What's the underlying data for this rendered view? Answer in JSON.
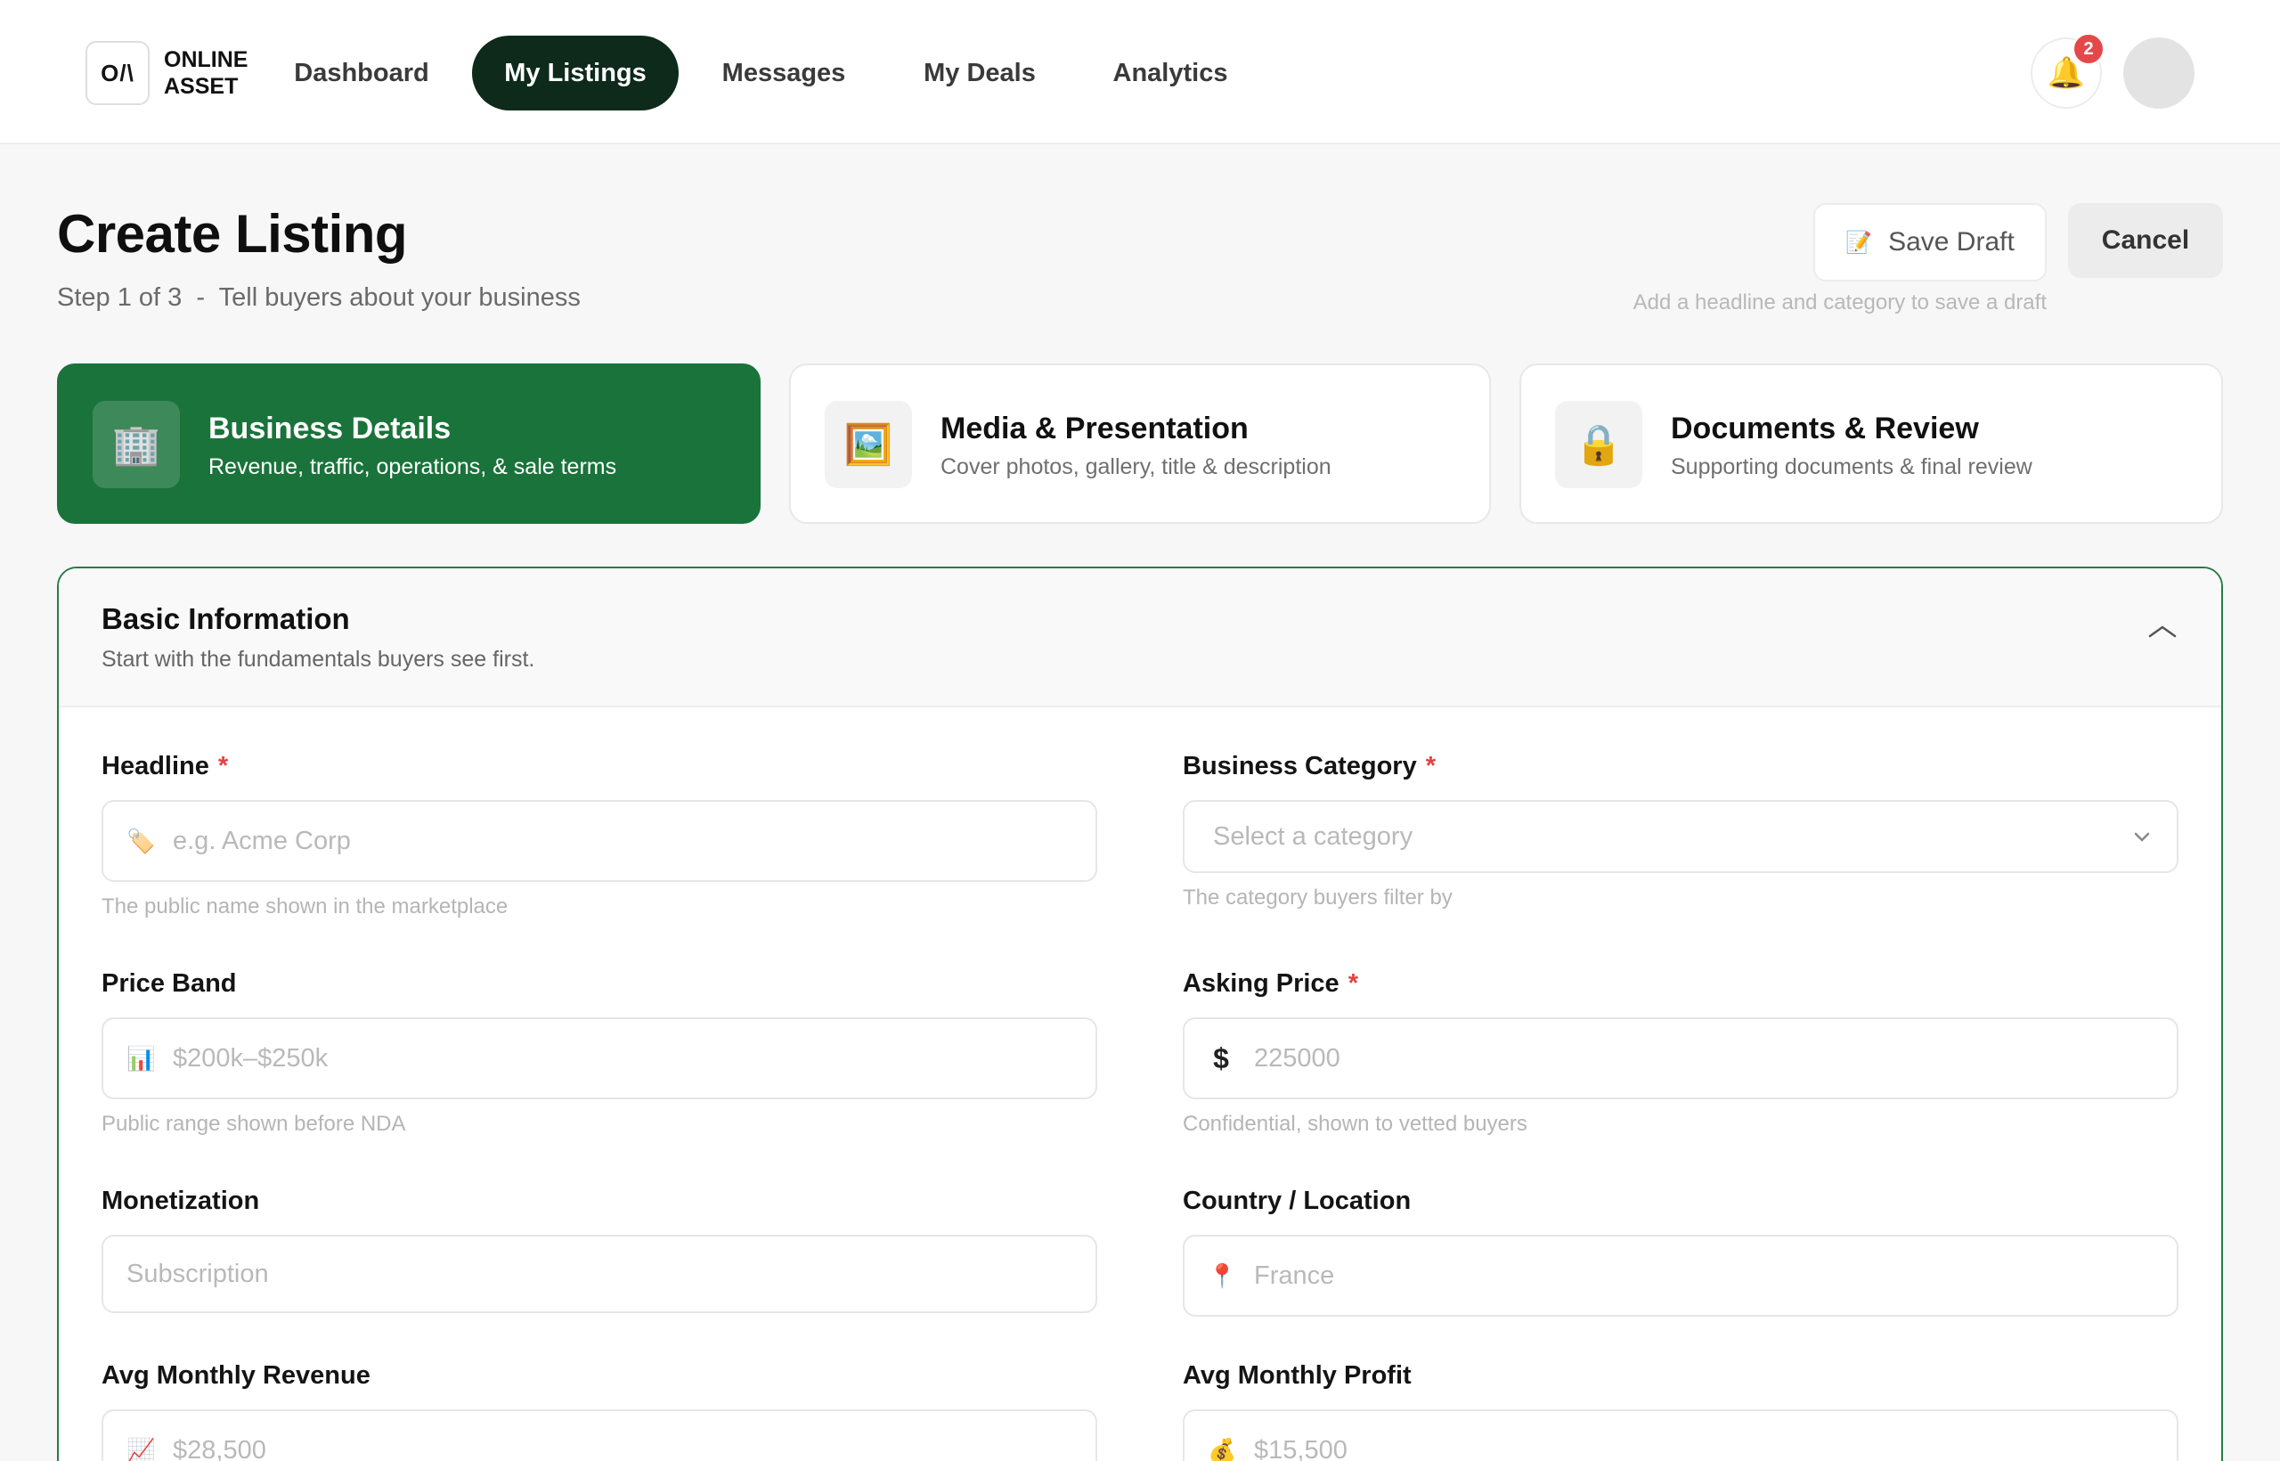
{
  "brand": {
    "logo_mark": "O/\\",
    "name": "ONLINE ASSET"
  },
  "nav": {
    "items": [
      {
        "label": "Dashboard"
      },
      {
        "label": "My Listings"
      },
      {
        "label": "Messages"
      },
      {
        "label": "My Deals"
      },
      {
        "label": "Analytics"
      }
    ],
    "active": "My Listings"
  },
  "notifications": {
    "count": "2",
    "icon": "bell-icon"
  },
  "page": {
    "title": "Create Listing",
    "subtitle": "Step 1 of 3  -  Tell buyers about your business",
    "save_draft_label": "Save Draft",
    "cancel_label": "Cancel",
    "save_hint": "Add a headline and category to save a draft"
  },
  "steps": [
    {
      "title": "Business Details",
      "desc": "Revenue, traffic, operations, & sale terms",
      "icon": "🏢"
    },
    {
      "title": "Media & Presentation",
      "desc": "Cover photos, gallery, title & description",
      "icon": "🖼️"
    },
    {
      "title": "Documents & Review",
      "desc": "Supporting documents & final review",
      "icon": "🔒"
    }
  ],
  "section": {
    "title": "Basic Information",
    "subtitle": "Start with the fundamentals buyers see first."
  },
  "fields": {
    "headline": {
      "label": "Headline",
      "required": "*",
      "placeholder": "e.g. Acme Corp",
      "help": "The public name shown in the marketplace",
      "icon": "🏷️"
    },
    "category": {
      "label": "Business Category",
      "required": "*",
      "placeholder": "Select a category",
      "help": "The category buyers filter by"
    },
    "price_band": {
      "label": "Price Band",
      "placeholder": "$200k–$250k",
      "help": "Public range shown before NDA",
      "icon": "📊"
    },
    "asking_price": {
      "label": "Asking Price",
      "required": "*",
      "placeholder": "225000",
      "help": "Confidential, shown to vetted buyers",
      "icon": "$"
    },
    "monetization": {
      "label": "Monetization",
      "placeholder": "Subscription"
    },
    "country": {
      "label": "Country / Location",
      "placeholder": "France",
      "icon": "📍"
    },
    "avg_revenue": {
      "label": "Avg Monthly Revenue",
      "placeholder": "$28,500",
      "icon": "📈"
    },
    "avg_profit": {
      "label": "Avg Monthly Profit",
      "placeholder": "$15,500",
      "icon": "💰"
    }
  },
  "colors": {
    "accent": "#1a733a",
    "nav_active": "#0d2a1b",
    "badge": "#e54848"
  }
}
